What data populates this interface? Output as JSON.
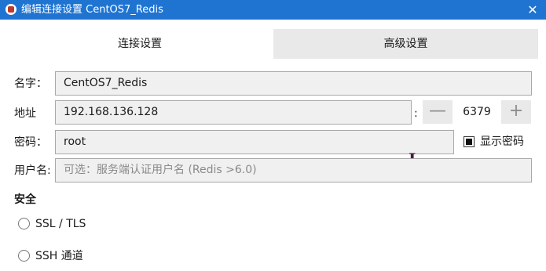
{
  "window": {
    "title": "编辑连接设置 CentOS7_Redis",
    "close_symbol": "✕"
  },
  "tabs": [
    {
      "label": "连接设置",
      "active": true
    },
    {
      "label": "高级设置",
      "active": false
    }
  ],
  "form": {
    "name": {
      "label": "名字：",
      "value": "CentOS7_Redis"
    },
    "address": {
      "label": "地址",
      "value": "192.168.136.128",
      "separator": ":"
    },
    "port": {
      "value": "6379",
      "decrement_symbol": "—",
      "increment_symbol": "+"
    },
    "password": {
      "label": "密码：",
      "value": "root"
    },
    "show_password": {
      "label": "显示密码",
      "checked": true
    },
    "username": {
      "label": "用户名:",
      "placeholder": "可选：服务端认证用户名 (Redis >6.0)"
    }
  },
  "security": {
    "title": "安全",
    "options": [
      {
        "label": "SSL / TLS",
        "selected": false
      },
      {
        "label": "SSH 通道",
        "selected": false
      }
    ]
  },
  "icons": {
    "app": "redis-app-icon",
    "close": "close-icon",
    "text_cursor": "text-cursor-icon"
  },
  "colors": {
    "titlebar": "#1f74d2",
    "field_background": "#f0f0f0",
    "inactive_tab": "#e9e9e9"
  }
}
